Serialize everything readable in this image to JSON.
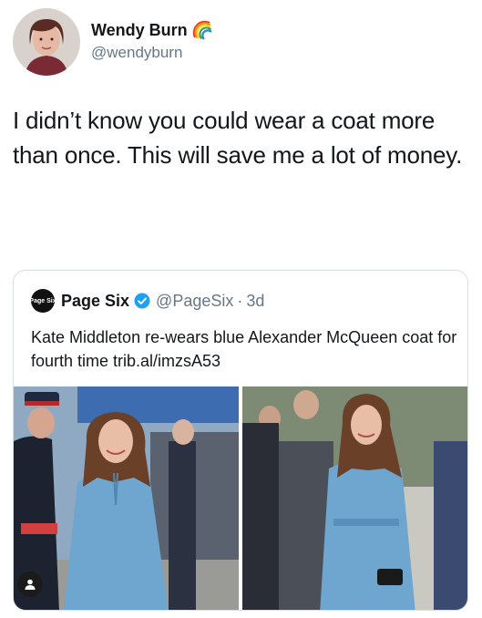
{
  "tweet": {
    "author": {
      "display_name": "Wendy Burn",
      "handle": "@wendyburn",
      "badge_icon": "rainbow-icon",
      "avatar_icon": "avatar"
    },
    "text": "I didn’t know you could wear a coat more than once. This will save me a lot of money."
  },
  "quoted_tweet": {
    "author": {
      "display_name": "Page Six",
      "handle": "@PageSix",
      "avatar_text": "Page Six",
      "verified_icon": "verified-icon"
    },
    "separator": "·",
    "time": "3d",
    "text": "Kate Middleton re-wears blue Alexander McQueen coat for fourth time trib.al/imzsA53",
    "media": [
      {
        "description_icon": "photo-kate-blue-coat-left"
      },
      {
        "description_icon": "photo-kate-blue-coat-right"
      }
    ],
    "user_badge_icon": "user-icon"
  },
  "colors": {
    "text": "#14171a",
    "secondary": "#657786",
    "verified": "#1da1f2",
    "coat": "#6ea6cf",
    "border": "#d8dde1"
  }
}
